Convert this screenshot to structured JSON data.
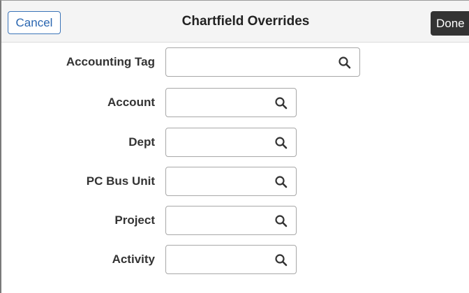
{
  "header": {
    "cancel_label": "Cancel",
    "title": "Chartfield Overrides",
    "done_label": "Done"
  },
  "fields": [
    {
      "label": "Accounting Tag",
      "value": "",
      "icon": "search-icon"
    },
    {
      "label": "Account",
      "value": "",
      "icon": "search-icon"
    },
    {
      "label": "Dept",
      "value": "",
      "icon": "search-icon"
    },
    {
      "label": "PC Bus Unit",
      "value": "",
      "icon": "search-icon"
    },
    {
      "label": "Project",
      "value": "",
      "icon": "search-icon"
    },
    {
      "label": "Activity",
      "value": "",
      "icon": "search-icon"
    }
  ],
  "colors": {
    "cancel_text": "#2a66b0",
    "done_bg": "#333333",
    "header_bg": "#f4f4f4"
  }
}
